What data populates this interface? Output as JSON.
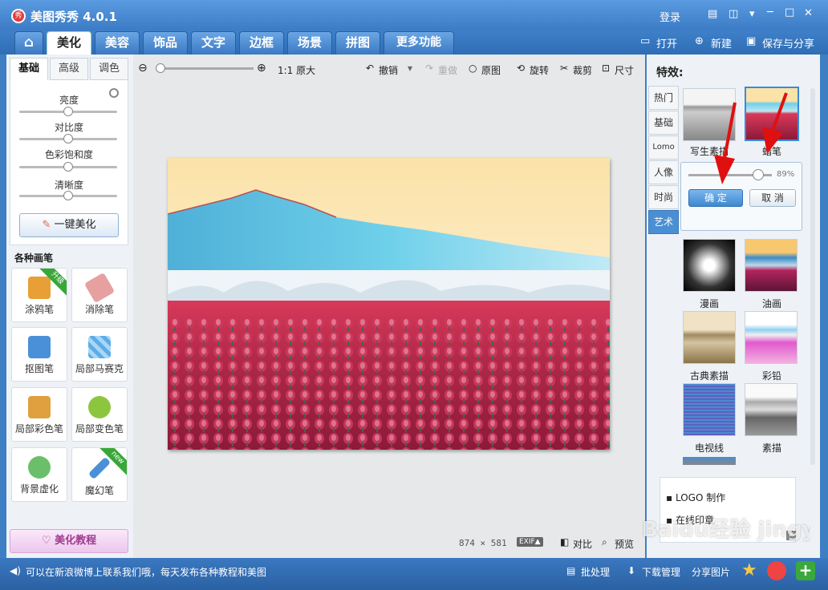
{
  "window": {
    "logo": "秀",
    "title": "美图秀秀 4.0.1",
    "login": "登录",
    "minimize": "─",
    "maximize": "□",
    "close": "✕"
  },
  "tabs": {
    "home": "⌂",
    "items": [
      "美化",
      "美容",
      "饰品",
      "文字",
      "边框",
      "场景",
      "拼图",
      "更多功能"
    ],
    "active": 0
  },
  "top_actions": {
    "open": "打开",
    "new": "新建",
    "save": "保存与分享"
  },
  "left": {
    "subtabs": [
      "基础",
      "高级",
      "调色"
    ],
    "sliders": [
      {
        "label": "亮度",
        "value": 0.5
      },
      {
        "label": "对比度",
        "value": 0.5
      },
      {
        "label": "色彩饱和度",
        "value": 0.5
      },
      {
        "label": "清晰度",
        "value": 0.5
      }
    ],
    "one_click": "一键美化",
    "brush_title": "各种画笔",
    "tools": [
      {
        "label": "涂鸦笔",
        "badge": "升级",
        "icon": "pencil-icon",
        "color": "#e8a036"
      },
      {
        "label": "消除笔",
        "badge": "",
        "icon": "eraser-icon",
        "color": "#e6a0a0"
      },
      {
        "label": "抠图笔",
        "badge": "",
        "icon": "cutout-pen-icon",
        "color": "#4a90d8"
      },
      {
        "label": "局部马赛克",
        "badge": "",
        "icon": "mosaic-icon",
        "color": "#5aaee8"
      },
      {
        "label": "局部彩色笔",
        "badge": "",
        "icon": "color-brush-icon",
        "color": "#e0a040"
      },
      {
        "label": "局部变色笔",
        "badge": "",
        "icon": "recolor-pen-icon",
        "color": "#8cc63f"
      },
      {
        "label": "背景虚化",
        "badge": "",
        "icon": "blur-bg-icon",
        "color": "#6bbf6b"
      },
      {
        "label": "魔幻笔",
        "badge": "new",
        "icon": "magic-pen-icon",
        "color": "#4a90d8"
      }
    ],
    "tutorial": "美化教程"
  },
  "toolbar": {
    "zoom_value": 0.04,
    "original_size": "1:1 原大",
    "undo": "撤销",
    "redo": "重做",
    "original": "原图",
    "rotate": "旋转",
    "crop": "裁剪",
    "resize": "尺寸"
  },
  "canvas": {
    "dims": "874 × 581",
    "exif": "EXIF▲",
    "compare": "对比",
    "preview": "预览"
  },
  "effects": {
    "title": "特效:",
    "categories": [
      "热门",
      "基础",
      "Lomo",
      "人像",
      "时尚",
      "艺术"
    ],
    "active_category": 5,
    "top_thumbs": [
      {
        "label": "写生素描"
      },
      {
        "label": "蜡笔"
      }
    ],
    "popup": {
      "percent": "89%",
      "value": 0.89,
      "ok": "确 定",
      "cancel": "取 消"
    },
    "thumbs": [
      {
        "label": "漫画"
      },
      {
        "label": "油画"
      },
      {
        "label": "古典素描"
      },
      {
        "label": "彩铅"
      },
      {
        "label": "电视线"
      },
      {
        "label": "素描"
      }
    ],
    "ads": [
      "LOGO 制作",
      "在线印章"
    ]
  },
  "status": {
    "message": "可以在新浪微博上联系我们哦，每天发布各种教程和美图",
    "batch": "批处理",
    "download": "下载管理",
    "share": "分享图片"
  },
  "watermark": "Baidu经验 jingyan.baidu.com"
}
